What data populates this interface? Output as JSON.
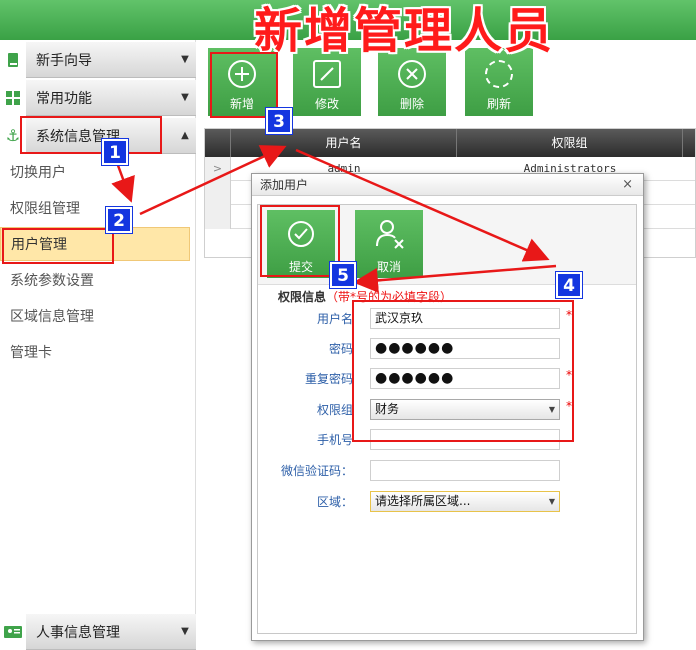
{
  "banner": {
    "title": "新增管理人员"
  },
  "sidebar": {
    "groups": [
      {
        "label": "新手向导",
        "icon": "book-icon"
      },
      {
        "label": "常用功能",
        "icon": "grid-icon"
      },
      {
        "label": "系统信息管理",
        "icon": "anchor-icon",
        "expanded": true
      },
      {
        "label": "人事信息管理",
        "icon": "id-card-icon"
      }
    ],
    "items": [
      {
        "label": "切换用户"
      },
      {
        "label": "权限组管理"
      },
      {
        "label": "用户管理",
        "active": true
      },
      {
        "label": "系统参数设置"
      },
      {
        "label": "区域信息管理"
      },
      {
        "label": "管理卡"
      }
    ]
  },
  "toolbar": {
    "buttons": [
      {
        "label": "新增",
        "icon": "plus-circle-icon"
      },
      {
        "label": "修改",
        "icon": "edit-icon"
      },
      {
        "label": "删除",
        "icon": "delete-circle-icon"
      },
      {
        "label": "刷新",
        "icon": "refresh-icon"
      }
    ]
  },
  "grid": {
    "columns": [
      "用户名",
      "权限组"
    ],
    "rows": [
      {
        "username": "admin",
        "group": "Administrators"
      }
    ]
  },
  "dialog": {
    "title": "添加用户",
    "close": "×",
    "submit_label": "提交",
    "cancel_label": "取消",
    "section_title": "权限信息",
    "section_note": "（带*号的为必填字段）",
    "fields": {
      "username": {
        "label": "用户名",
        "value": "武汉京玖",
        "required": "*"
      },
      "password": {
        "label": "密码",
        "value": "●●●●●●"
      },
      "password_confirm": {
        "label": "重复密码",
        "value": "●●●●●●",
        "required": "*"
      },
      "group": {
        "label": "权限组",
        "value": "财务",
        "required": "*"
      },
      "phone": {
        "label": "手机号",
        "value": ""
      },
      "wechat": {
        "label": "微信验证码：",
        "value": ""
      },
      "area": {
        "label": "区域：",
        "value": "请选择所属区域..."
      }
    }
  },
  "annotations": {
    "steps": [
      "1",
      "2",
      "3",
      "4",
      "5"
    ]
  },
  "colors": {
    "accent_green": "#4caf50",
    "annotation_red": "#e81818",
    "badge_blue": "#1436e0",
    "active_item": "#ffe7a8"
  }
}
